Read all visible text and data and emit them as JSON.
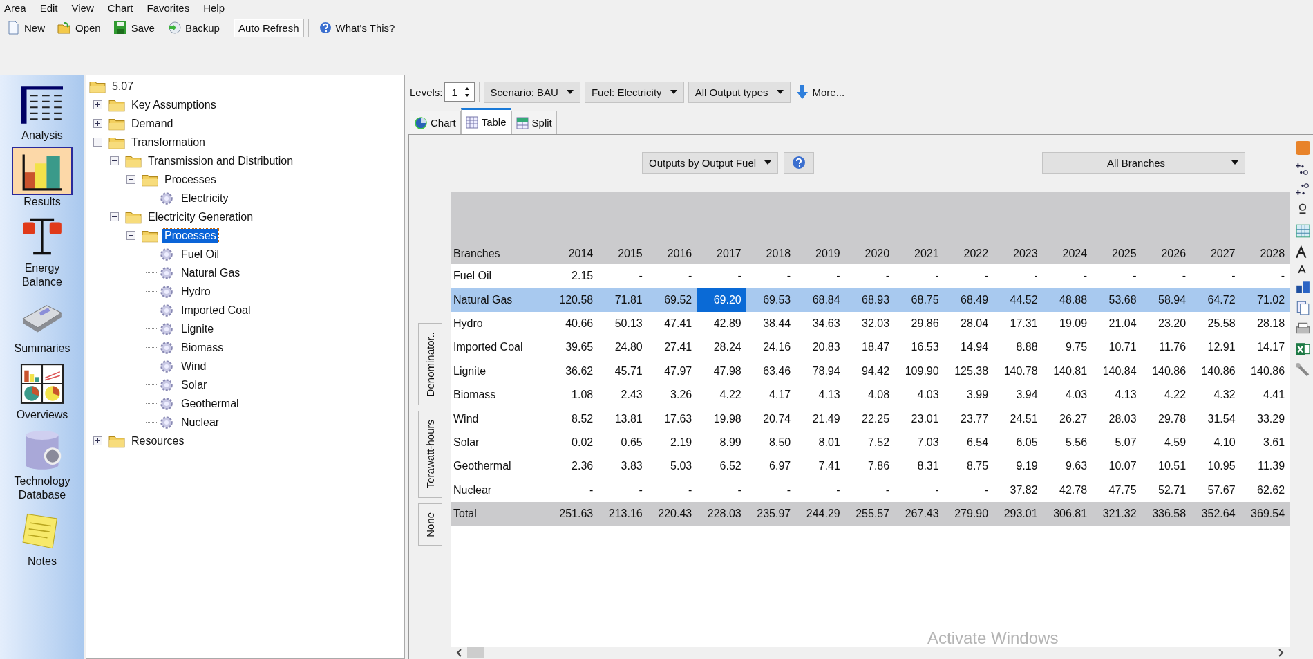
{
  "menu": [
    "Area",
    "Edit",
    "View",
    "Chart",
    "Favorites",
    "Help"
  ],
  "toolbar": [
    {
      "label": "New",
      "kind": "new",
      "pressed": false
    },
    {
      "label": "Open",
      "kind": "open",
      "pressed": false
    },
    {
      "label": "Save",
      "kind": "save",
      "pressed": false
    },
    {
      "label": "Backup",
      "kind": "backup",
      "pressed": false
    },
    {
      "label": "Auto Refresh",
      "kind": "toggle",
      "pressed": true
    },
    {
      "label": "What's This?",
      "kind": "help",
      "pressed": false
    }
  ],
  "sidebar": [
    {
      "label": "Analysis",
      "kind": "analysis",
      "selected": false
    },
    {
      "label": "Results",
      "kind": "results",
      "selected": true
    },
    {
      "label": "Energy Balance",
      "kind": "balance",
      "selected": false
    },
    {
      "label": "Summaries",
      "kind": "summaries",
      "selected": false
    },
    {
      "label": "Overviews",
      "kind": "overviews",
      "selected": false
    },
    {
      "label": "Technology Database",
      "kind": "database",
      "selected": false
    },
    {
      "label": "Notes",
      "kind": "notes",
      "selected": false
    }
  ],
  "tree": {
    "label": "5.07",
    "kind": "folder",
    "selected": false,
    "children": [
      {
        "label": "Key Assumptions",
        "kind": "folder",
        "expanded": false,
        "selected": false
      },
      {
        "label": "Demand",
        "kind": "folder",
        "expanded": false,
        "selected": false
      },
      {
        "label": "Transformation",
        "kind": "folder",
        "expanded": true,
        "selected": false,
        "children": [
          {
            "label": "Transmission and Distribution",
            "kind": "folder",
            "expanded": true,
            "selected": false,
            "children": [
              {
                "label": "Processes",
                "kind": "folder",
                "expanded": true,
                "selected": false,
                "children": [
                  {
                    "label": "Electricity",
                    "kind": "process",
                    "selected": false
                  }
                ]
              }
            ]
          },
          {
            "label": "Electricity Generation",
            "kind": "folder",
            "expanded": true,
            "selected": false,
            "children": [
              {
                "label": "Processes",
                "kind": "folder",
                "expanded": true,
                "selected": true,
                "children": [
                  {
                    "label": "Fuel Oil",
                    "kind": "process",
                    "selected": false
                  },
                  {
                    "label": "Natural Gas",
                    "kind": "process",
                    "selected": false
                  },
                  {
                    "label": "Hydro",
                    "kind": "process",
                    "selected": false
                  },
                  {
                    "label": "Imported Coal",
                    "kind": "process",
                    "selected": false
                  },
                  {
                    "label": "Lignite",
                    "kind": "process",
                    "selected": false
                  },
                  {
                    "label": "Biomass",
                    "kind": "process",
                    "selected": false
                  },
                  {
                    "label": "Wind",
                    "kind": "process",
                    "selected": false
                  },
                  {
                    "label": "Solar",
                    "kind": "process",
                    "selected": false
                  },
                  {
                    "label": "Geothermal",
                    "kind": "process",
                    "selected": false
                  },
                  {
                    "label": "Nuclear",
                    "kind": "process",
                    "selected": false
                  }
                ]
              }
            ]
          }
        ]
      },
      {
        "label": "Resources",
        "kind": "folder",
        "expanded": false,
        "selected": false
      }
    ]
  },
  "controls": {
    "levels_label": "Levels:",
    "levels_value": "1",
    "dropdowns": [
      "Scenario: BAU",
      "Fuel: Electricity",
      "All Output types"
    ],
    "more": "More..."
  },
  "tabs": [
    {
      "label": "Chart",
      "kind": "chart",
      "selected": false
    },
    {
      "label": "Table",
      "kind": "table",
      "selected": true
    },
    {
      "label": "Split",
      "kind": "split",
      "selected": false
    }
  ],
  "view_dropdown": "Outputs by Output Fuel",
  "branch_dropdown": "All Branches",
  "side_buttons": [
    "Denominator..",
    "Terawatt-hours",
    "None"
  ],
  "table": {
    "row_header": "Branches",
    "columns": [
      "2014",
      "2015",
      "2016",
      "2017",
      "2018",
      "2019",
      "2020",
      "2021",
      "2022",
      "2023",
      "2024",
      "2025",
      "2026",
      "2027",
      "2028"
    ],
    "rows": [
      {
        "name": "Fuel Oil",
        "kind": "data",
        "selected": false,
        "cells": [
          {
            "v": "2.15",
            "selected": false
          },
          {
            "v": "-",
            "selected": false
          },
          {
            "v": "-",
            "selected": false
          },
          {
            "v": "-",
            "selected": false
          },
          {
            "v": "-",
            "selected": false
          },
          {
            "v": "-",
            "selected": false
          },
          {
            "v": "-",
            "selected": false
          },
          {
            "v": "-",
            "selected": false
          },
          {
            "v": "-",
            "selected": false
          },
          {
            "v": "-",
            "selected": false
          },
          {
            "v": "-",
            "selected": false
          },
          {
            "v": "-",
            "selected": false
          },
          {
            "v": "-",
            "selected": false
          },
          {
            "v": "-",
            "selected": false
          },
          {
            "v": "-",
            "selected": false
          }
        ]
      },
      {
        "name": "Natural Gas",
        "kind": "data",
        "selected": true,
        "cells": [
          {
            "v": "120.58",
            "selected": false
          },
          {
            "v": "71.81",
            "selected": false
          },
          {
            "v": "69.52",
            "selected": false
          },
          {
            "v": "69.20",
            "selected": true
          },
          {
            "v": "69.53",
            "selected": false
          },
          {
            "v": "68.84",
            "selected": false
          },
          {
            "v": "68.93",
            "selected": false
          },
          {
            "v": "68.75",
            "selected": false
          },
          {
            "v": "68.49",
            "selected": false
          },
          {
            "v": "44.52",
            "selected": false
          },
          {
            "v": "48.88",
            "selected": false
          },
          {
            "v": "53.68",
            "selected": false
          },
          {
            "v": "58.94",
            "selected": false
          },
          {
            "v": "64.72",
            "selected": false
          },
          {
            "v": "71.02",
            "selected": false
          }
        ]
      },
      {
        "name": "Hydro",
        "kind": "data",
        "selected": false,
        "cells": [
          {
            "v": "40.66",
            "selected": false
          },
          {
            "v": "50.13",
            "selected": false
          },
          {
            "v": "47.41",
            "selected": false
          },
          {
            "v": "42.89",
            "selected": false
          },
          {
            "v": "38.44",
            "selected": false
          },
          {
            "v": "34.63",
            "selected": false
          },
          {
            "v": "32.03",
            "selected": false
          },
          {
            "v": "29.86",
            "selected": false
          },
          {
            "v": "28.04",
            "selected": false
          },
          {
            "v": "17.31",
            "selected": false
          },
          {
            "v": "19.09",
            "selected": false
          },
          {
            "v": "21.04",
            "selected": false
          },
          {
            "v": "23.20",
            "selected": false
          },
          {
            "v": "25.58",
            "selected": false
          },
          {
            "v": "28.18",
            "selected": false
          }
        ]
      },
      {
        "name": "Imported Coal",
        "kind": "data",
        "selected": false,
        "cells": [
          {
            "v": "39.65",
            "selected": false
          },
          {
            "v": "24.80",
            "selected": false
          },
          {
            "v": "27.41",
            "selected": false
          },
          {
            "v": "28.24",
            "selected": false
          },
          {
            "v": "24.16",
            "selected": false
          },
          {
            "v": "20.83",
            "selected": false
          },
          {
            "v": "18.47",
            "selected": false
          },
          {
            "v": "16.53",
            "selected": false
          },
          {
            "v": "14.94",
            "selected": false
          },
          {
            "v": "8.88",
            "selected": false
          },
          {
            "v": "9.75",
            "selected": false
          },
          {
            "v": "10.71",
            "selected": false
          },
          {
            "v": "11.76",
            "selected": false
          },
          {
            "v": "12.91",
            "selected": false
          },
          {
            "v": "14.17",
            "selected": false
          }
        ]
      },
      {
        "name": "Lignite",
        "kind": "data",
        "selected": false,
        "cells": [
          {
            "v": "36.62",
            "selected": false
          },
          {
            "v": "45.71",
            "selected": false
          },
          {
            "v": "47.97",
            "selected": false
          },
          {
            "v": "47.98",
            "selected": false
          },
          {
            "v": "63.46",
            "selected": false
          },
          {
            "v": "78.94",
            "selected": false
          },
          {
            "v": "94.42",
            "selected": false
          },
          {
            "v": "109.90",
            "selected": false
          },
          {
            "v": "125.38",
            "selected": false
          },
          {
            "v": "140.78",
            "selected": false
          },
          {
            "v": "140.81",
            "selected": false
          },
          {
            "v": "140.84",
            "selected": false
          },
          {
            "v": "140.86",
            "selected": false
          },
          {
            "v": "140.86",
            "selected": false
          },
          {
            "v": "140.86",
            "selected": false
          }
        ]
      },
      {
        "name": "Biomass",
        "kind": "data",
        "selected": false,
        "cells": [
          {
            "v": "1.08",
            "selected": false
          },
          {
            "v": "2.43",
            "selected": false
          },
          {
            "v": "3.26",
            "selected": false
          },
          {
            "v": "4.22",
            "selected": false
          },
          {
            "v": "4.17",
            "selected": false
          },
          {
            "v": "4.13",
            "selected": false
          },
          {
            "v": "4.08",
            "selected": false
          },
          {
            "v": "4.03",
            "selected": false
          },
          {
            "v": "3.99",
            "selected": false
          },
          {
            "v": "3.94",
            "selected": false
          },
          {
            "v": "4.03",
            "selected": false
          },
          {
            "v": "4.13",
            "selected": false
          },
          {
            "v": "4.22",
            "selected": false
          },
          {
            "v": "4.32",
            "selected": false
          },
          {
            "v": "4.41",
            "selected": false
          }
        ]
      },
      {
        "name": "Wind",
        "kind": "data",
        "selected": false,
        "cells": [
          {
            "v": "8.52",
            "selected": false
          },
          {
            "v": "13.81",
            "selected": false
          },
          {
            "v": "17.63",
            "selected": false
          },
          {
            "v": "19.98",
            "selected": false
          },
          {
            "v": "20.74",
            "selected": false
          },
          {
            "v": "21.49",
            "selected": false
          },
          {
            "v": "22.25",
            "selected": false
          },
          {
            "v": "23.01",
            "selected": false
          },
          {
            "v": "23.77",
            "selected": false
          },
          {
            "v": "24.51",
            "selected": false
          },
          {
            "v": "26.27",
            "selected": false
          },
          {
            "v": "28.03",
            "selected": false
          },
          {
            "v": "29.78",
            "selected": false
          },
          {
            "v": "31.54",
            "selected": false
          },
          {
            "v": "33.29",
            "selected": false
          }
        ]
      },
      {
        "name": "Solar",
        "kind": "data",
        "selected": false,
        "cells": [
          {
            "v": "0.02",
            "selected": false
          },
          {
            "v": "0.65",
            "selected": false
          },
          {
            "v": "2.19",
            "selected": false
          },
          {
            "v": "8.99",
            "selected": false
          },
          {
            "v": "8.50",
            "selected": false
          },
          {
            "v": "8.01",
            "selected": false
          },
          {
            "v": "7.52",
            "selected": false
          },
          {
            "v": "7.03",
            "selected": false
          },
          {
            "v": "6.54",
            "selected": false
          },
          {
            "v": "6.05",
            "selected": false
          },
          {
            "v": "5.56",
            "selected": false
          },
          {
            "v": "5.07",
            "selected": false
          },
          {
            "v": "4.59",
            "selected": false
          },
          {
            "v": "4.10",
            "selected": false
          },
          {
            "v": "3.61",
            "selected": false
          }
        ]
      },
      {
        "name": "Geothermal",
        "kind": "data",
        "selected": false,
        "cells": [
          {
            "v": "2.36",
            "selected": false
          },
          {
            "v": "3.83",
            "selected": false
          },
          {
            "v": "5.03",
            "selected": false
          },
          {
            "v": "6.52",
            "selected": false
          },
          {
            "v": "6.97",
            "selected": false
          },
          {
            "v": "7.41",
            "selected": false
          },
          {
            "v": "7.86",
            "selected": false
          },
          {
            "v": "8.31",
            "selected": false
          },
          {
            "v": "8.75",
            "selected": false
          },
          {
            "v": "9.19",
            "selected": false
          },
          {
            "v": "9.63",
            "selected": false
          },
          {
            "v": "10.07",
            "selected": false
          },
          {
            "v": "10.51",
            "selected": false
          },
          {
            "v": "10.95",
            "selected": false
          },
          {
            "v": "11.39",
            "selected": false
          }
        ]
      },
      {
        "name": "Nuclear",
        "kind": "data",
        "selected": false,
        "cells": [
          {
            "v": "-",
            "selected": false
          },
          {
            "v": "-",
            "selected": false
          },
          {
            "v": "-",
            "selected": false
          },
          {
            "v": "-",
            "selected": false
          },
          {
            "v": "-",
            "selected": false
          },
          {
            "v": "-",
            "selected": false
          },
          {
            "v": "-",
            "selected": false
          },
          {
            "v": "-",
            "selected": false
          },
          {
            "v": "-",
            "selected": false
          },
          {
            "v": "37.82",
            "selected": false
          },
          {
            "v": "42.78",
            "selected": false
          },
          {
            "v": "47.75",
            "selected": false
          },
          {
            "v": "52.71",
            "selected": false
          },
          {
            "v": "57.67",
            "selected": false
          },
          {
            "v": "62.62",
            "selected": false
          }
        ]
      },
      {
        "name": "Total",
        "kind": "total",
        "selected": false,
        "cells": [
          {
            "v": "251.63",
            "selected": false
          },
          {
            "v": "213.16",
            "selected": false
          },
          {
            "v": "220.43",
            "selected": false
          },
          {
            "v": "228.03",
            "selected": false
          },
          {
            "v": "235.97",
            "selected": false
          },
          {
            "v": "244.29",
            "selected": false
          },
          {
            "v": "255.57",
            "selected": false
          },
          {
            "v": "267.43",
            "selected": false
          },
          {
            "v": "279.90",
            "selected": false
          },
          {
            "v": "293.01",
            "selected": false
          },
          {
            "v": "306.81",
            "selected": false
          },
          {
            "v": "321.32",
            "selected": false
          },
          {
            "v": "336.58",
            "selected": false
          },
          {
            "v": "352.64",
            "selected": false
          },
          {
            "v": "369.54",
            "selected": false
          }
        ]
      }
    ]
  },
  "os_notice": "Activate Windows"
}
